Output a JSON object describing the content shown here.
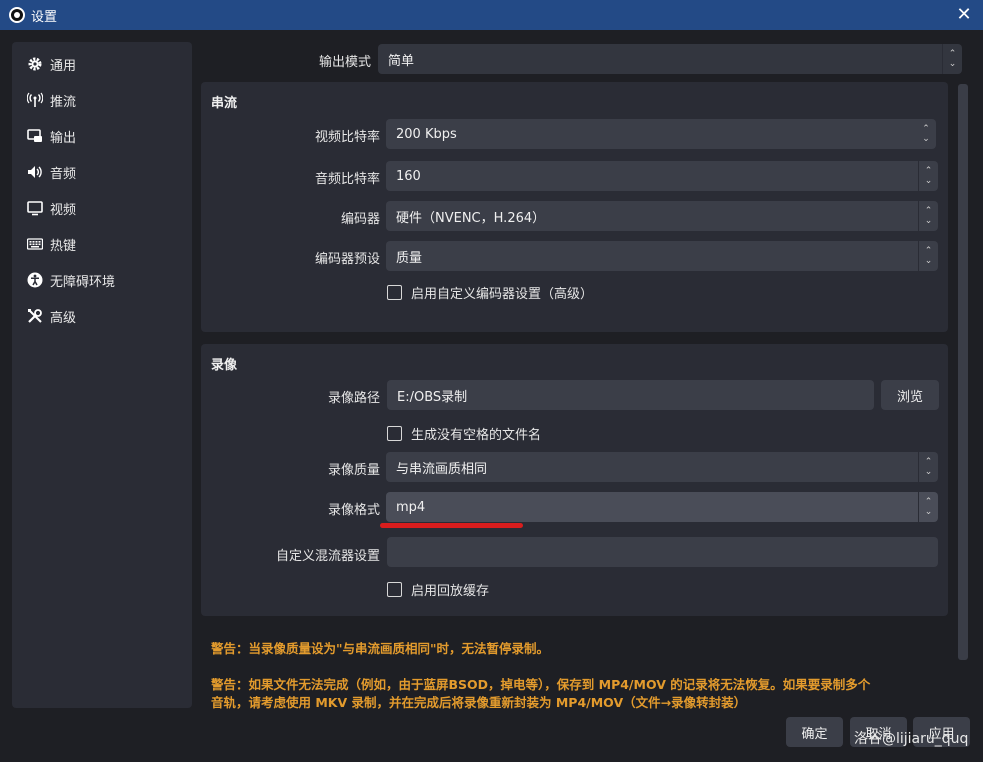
{
  "window": {
    "title": "设置"
  },
  "sidebar": {
    "items": [
      {
        "label": "通用",
        "icon": "gear-icon"
      },
      {
        "label": "推流",
        "icon": "antenna-icon"
      },
      {
        "label": "输出",
        "icon": "output-icon"
      },
      {
        "label": "音频",
        "icon": "speaker-icon"
      },
      {
        "label": "视频",
        "icon": "monitor-icon"
      },
      {
        "label": "热键",
        "icon": "keyboard-icon"
      },
      {
        "label": "无障碍环境",
        "icon": "accessibility-icon"
      },
      {
        "label": "高级",
        "icon": "tools-icon"
      }
    ]
  },
  "output_mode": {
    "label": "输出模式",
    "value": "简单"
  },
  "streaming": {
    "title": "串流",
    "video_bitrate": {
      "label": "视频比特率",
      "value": "200 Kbps"
    },
    "audio_bitrate": {
      "label": "音频比特率",
      "value": "160"
    },
    "encoder": {
      "label": "编码器",
      "value": "硬件（NVENC，H.264）"
    },
    "encoder_preset": {
      "label": "编码器预设",
      "value": "质量"
    },
    "custom_encoder": {
      "label": "启用自定义编码器设置（高级）",
      "checked": false
    }
  },
  "recording": {
    "title": "录像",
    "path": {
      "label": "录像路径",
      "value": "E:/OBS录制",
      "browse": "浏览"
    },
    "no_space": {
      "label": "生成没有空格的文件名",
      "checked": false
    },
    "quality": {
      "label": "录像质量",
      "value": "与串流画质相同"
    },
    "format": {
      "label": "录像格式",
      "value": "mp4"
    },
    "muxer": {
      "label": "自定义混流器设置",
      "value": ""
    },
    "replay_buffer": {
      "label": "启用回放缓存",
      "checked": false
    }
  },
  "warnings": {
    "w1": "警告：当录像质量设为\"与串流画质相同\"时，无法暂停录制。",
    "w2_line1": "警告：如果文件无法完成（例如，由于蓝屏BSOD，掉电等），保存到 MP4/MOV 的记录将无法恢复。如果要录制多个",
    "w2_line2": "音轨，请考虑使用 MKV 录制，并在完成后将录像重新封装为 MP4/MOV（文件→录像转封装）"
  },
  "buttons": {
    "ok": "确定",
    "cancel": "取消",
    "apply": "应用"
  },
  "watermark": "洛谷@lijiaru_quq",
  "colors": {
    "titlebar": "#234a86",
    "warning": "#e39b2d",
    "highlight": "#d91d1d"
  }
}
